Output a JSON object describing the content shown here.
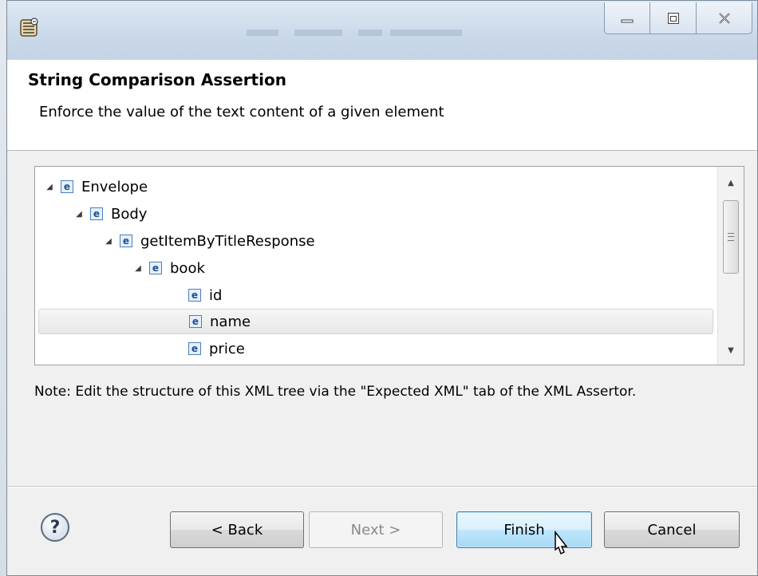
{
  "header": {
    "title": "String Comparison Assertion",
    "description": "Enforce the value of the text content of a given element"
  },
  "tree": {
    "element_icon": "e",
    "items": [
      {
        "label": "Envelope",
        "expanded": true
      },
      {
        "label": "Body",
        "expanded": true
      },
      {
        "label": "getItemByTitleResponse",
        "expanded": true
      },
      {
        "label": "book",
        "expanded": true
      },
      {
        "label": "id"
      },
      {
        "label": "name",
        "selected": true
      },
      {
        "label": "price"
      }
    ]
  },
  "note": "Note: Edit the structure of this XML tree via the \"Expected XML\" tab of the XML Assertor.",
  "buttons": {
    "help": "?",
    "back": "< Back",
    "next": "Next >",
    "finish": "Finish",
    "cancel": "Cancel"
  },
  "icons": {
    "app": "app-icon",
    "minimize": "minimize-icon",
    "maximize": "maximize-icon",
    "close": "close-icon",
    "expand": "expanded-triangle-icon",
    "element": "element-icon",
    "help": "help-icon",
    "cursor": "mouse-cursor-icon"
  },
  "colors": {
    "focus_button": "#bee6fd",
    "icon_border": "#4a7fbf"
  }
}
